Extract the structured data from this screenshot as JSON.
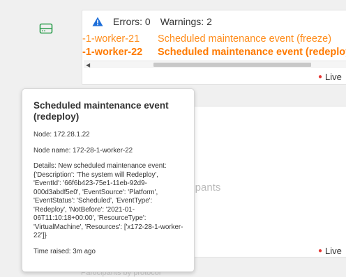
{
  "alerts": {
    "errors_label": "Errors: 0",
    "warnings_label": "Warnings: 2",
    "rows": [
      {
        "node": "-1-worker-21",
        "message": "Scheduled maintenance event (freeze)"
      },
      {
        "node": "-1-worker-22",
        "message": "Scheduled maintenance event (redeploy"
      }
    ],
    "live_label": "Live"
  },
  "participants": {
    "title": "Participants",
    "live_label": "Live",
    "below_text": "Participants by protocol"
  },
  "tooltip": {
    "title": "Scheduled maintenance event (redeploy)",
    "node": "Node: 172.28.1.22",
    "node_name": "Node name: 172-28-1-worker-22",
    "details": "Details: New scheduled maintenance event: {'Description': 'The system will Redeploy', 'EventId': '66f6b423-75e1-11eb-92d9-000d3abdf5e0', 'EventSource': 'Platform', 'EventStatus': 'Scheduled', 'EventType': 'Redeploy', 'NotBefore': '2021-01-06T11:10:18+00:00', 'ResourceType': 'VirtualMachine', 'Resources': ['x172-28-1-worker-22']}",
    "time_raised": "Time raised: 3m ago"
  },
  "colors": {
    "warning_orange": "#ff8c1a",
    "warning_icon_blue": "#1e6fd9",
    "drive_icon_green": "#2e9e4f",
    "live_dot_red": "#e53935"
  },
  "icons": {
    "sidebar": "drive-icon",
    "alerts": "warning-triangle-icon"
  }
}
